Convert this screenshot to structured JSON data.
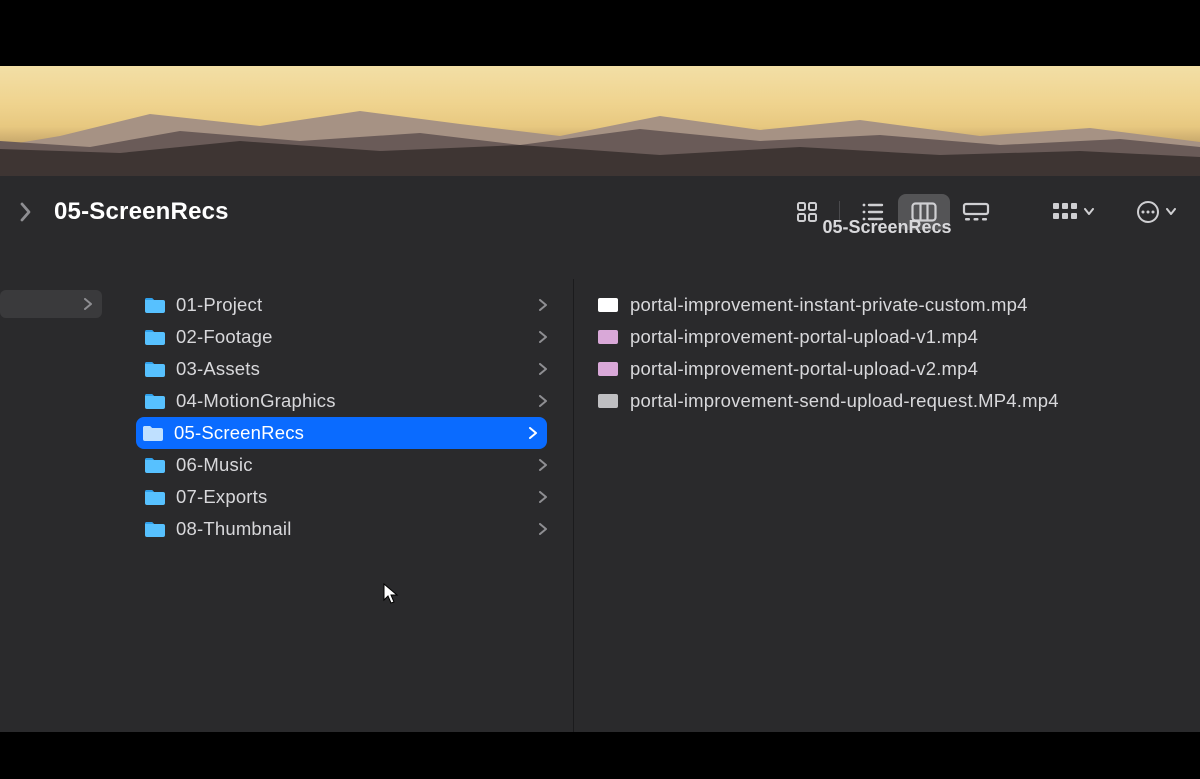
{
  "header": {
    "title": "05-ScreenRecs"
  },
  "column_header": "05-ScreenRecs",
  "folders": [
    {
      "name": "01-Project",
      "selected": false,
      "has_children": true
    },
    {
      "name": "02-Footage",
      "selected": false,
      "has_children": true
    },
    {
      "name": "03-Assets",
      "selected": false,
      "has_children": true
    },
    {
      "name": "04-MotionGraphics",
      "selected": false,
      "has_children": true
    },
    {
      "name": "05-ScreenRecs",
      "selected": true,
      "has_children": true
    },
    {
      "name": "06-Music",
      "selected": false,
      "has_children": true
    },
    {
      "name": "07-Exports",
      "selected": false,
      "has_children": true
    },
    {
      "name": "08-Thumbnail",
      "selected": false,
      "has_children": true
    }
  ],
  "files": [
    {
      "name": "portal-improvement-instant-private-custom.mp4",
      "thumb_color": "#ffffff"
    },
    {
      "name": "portal-improvement-portal-upload-v1.mp4",
      "thumb_color": "#d9a8d8"
    },
    {
      "name": "portal-improvement-portal-upload-v2.mp4",
      "thumb_color": "#d9a8d8"
    },
    {
      "name": "portal-improvement-send-upload-request.MP4.mp4",
      "thumb_color": "#bfbfc2"
    }
  ],
  "colors": {
    "selection": "#0a6bff",
    "folder_fill": "#57c1ff",
    "folder_tab": "#2ea0ec"
  }
}
